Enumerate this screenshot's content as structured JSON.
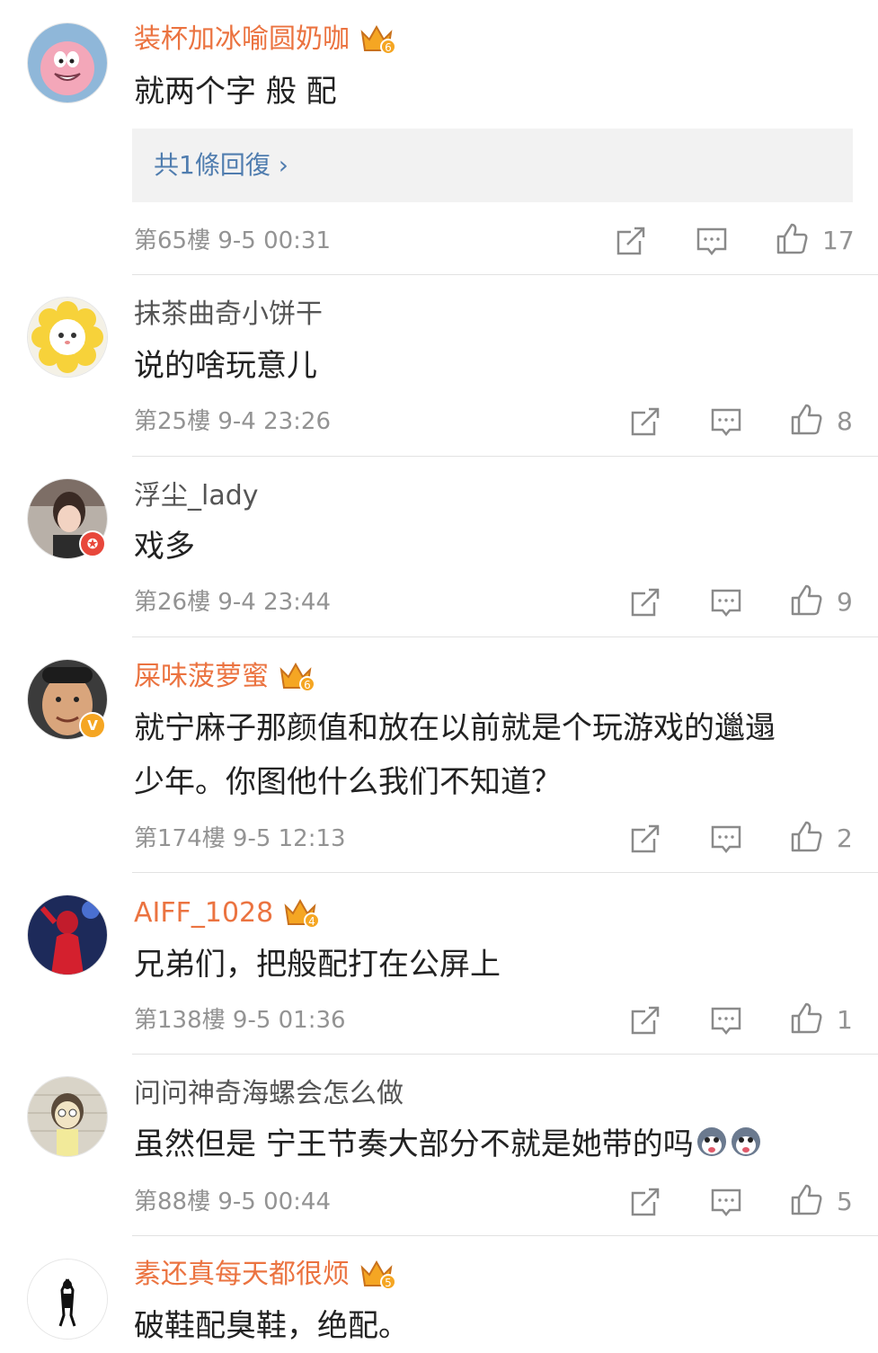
{
  "comments": [
    {
      "username": "装杯加冰喻圆奶咖",
      "name_style": "vip",
      "crown_level": "6",
      "lines": [
        "就两个字 般 配"
      ],
      "reply_link": "共1條回復 ›",
      "floor": "第65樓",
      "time": "9-5 00:31",
      "likes": "17",
      "avatar_icon": "cartoon-starfish-avatar"
    },
    {
      "username": "抹茶曲奇小饼干",
      "name_style": "plain",
      "lines": [
        "说的啥玩意儿"
      ],
      "floor": "第25樓",
      "time": "9-4 23:26",
      "likes": "8",
      "avatar_icon": "flower-cat-avatar"
    },
    {
      "username": "浮尘_lady",
      "name_style": "plain",
      "lines": [
        "戏多"
      ],
      "floor": "第26樓",
      "time": "9-4 23:44",
      "likes": "9",
      "avatar_icon": "photo-girl-avatar"
    },
    {
      "username": "屎味菠萝蜜",
      "name_style": "vip",
      "crown_level": "6",
      "lines": [
        "就宁麻子那颜值和放在以前就是个玩游戏的邋遢",
        "少年。你图他什么我们不知道？"
      ],
      "floor": "第174樓",
      "time": "9-5 12:13",
      "likes": "2",
      "avatar_icon": "photo-man-avatar"
    },
    {
      "username": "AIFF_1028",
      "name_style": "vip",
      "crown_level": "4",
      "lines": [
        "兄弟们，把般配打在公屏上"
      ],
      "floor": "第138樓",
      "time": "9-5 01:36",
      "likes": "1",
      "avatar_icon": "photo-red-performer-avatar"
    },
    {
      "username": "问问神奇海螺会怎么做",
      "name_style": "plain",
      "lines": [
        "虽然但是 宁王节奏大部分不就是她带的吗"
      ],
      "floor": "第88樓",
      "time": "9-5 00:44",
      "likes": "5",
      "avatar_icon": "cartoon-boy-avatar",
      "trailing_emoji": [
        "husky-emoji",
        "husky-emoji"
      ]
    },
    {
      "username": "素还真每天都很烦",
      "name_style": "vip",
      "crown_level": "5",
      "lines": [
        "破鞋配臭鞋，绝配。"
      ],
      "avatar_icon": "ink-figure-avatar"
    }
  ],
  "colors": {
    "vip_name": "#eb7340",
    "plain_name": "#555555",
    "meta": "#939393",
    "reply_link": "#507daf",
    "crown": "#f5a623"
  }
}
